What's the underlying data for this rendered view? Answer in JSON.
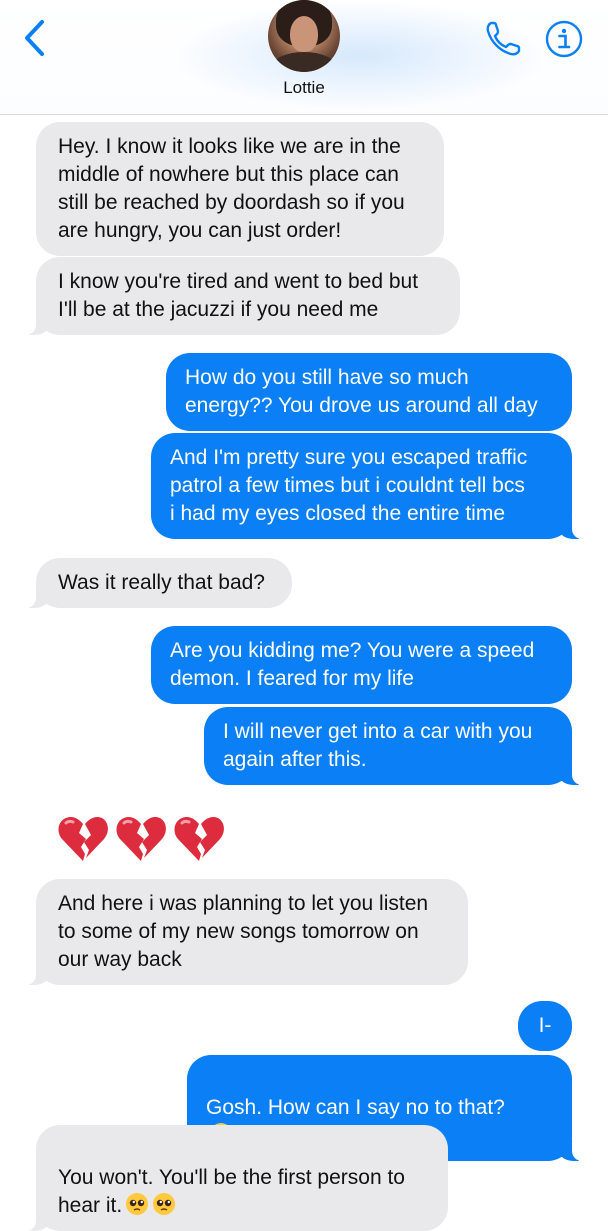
{
  "header": {
    "contact_name": "Lottie",
    "back_icon": "chevron-left-icon",
    "phone_icon": "phone-icon",
    "info_icon": "info-icon",
    "accent_color": "#0b7ff5"
  },
  "messages": [
    {
      "sender": "contact",
      "text": "Hey. I know it looks like we are in the\nmiddle of nowhere but this place can\nstill be reached by doordash so if you\nare hungry, you can just order!"
    },
    {
      "sender": "contact",
      "text": "I know you're tired and went to bed but\nI'll be at the jacuzzi if you need me"
    },
    {
      "sender": "me",
      "text": "How do you still have so much\nenergy?? You drove us around all day"
    },
    {
      "sender": "me",
      "text": "And I'm pretty sure you escaped traffic\npatrol a few times but i couldnt tell bcs\ni had my eyes closed the entire time"
    },
    {
      "sender": "contact",
      "text": "Was it really that bad?"
    },
    {
      "sender": "me",
      "text": "Are you kidding me? You were a speed\ndemon. I feared for my life"
    },
    {
      "sender": "me",
      "text": "I will never get into a car with you\nagain after this."
    },
    {
      "sender": "contact",
      "emoji": "💔💔💔",
      "emoji_names": [
        "broken-heart-icon",
        "broken-heart-icon",
        "broken-heart-icon"
      ]
    },
    {
      "sender": "contact",
      "text": "And here i was planning to let you listen\nto some of my new songs tomorrow on\nour way back"
    },
    {
      "sender": "me",
      "text": "I-"
    },
    {
      "sender": "me",
      "text": "Gosh. How can I say no to that?",
      "trailing_emoji": "loudly-crying-face-icon"
    },
    {
      "sender": "contact",
      "text": "You won't. You'll be the first person to\nhear it.",
      "trailing_emoji": "pleading-face-icon x2"
    }
  ],
  "colors": {
    "incoming_bubble": "#e9e9eb",
    "outgoing_bubble": "#0b7ff5"
  }
}
